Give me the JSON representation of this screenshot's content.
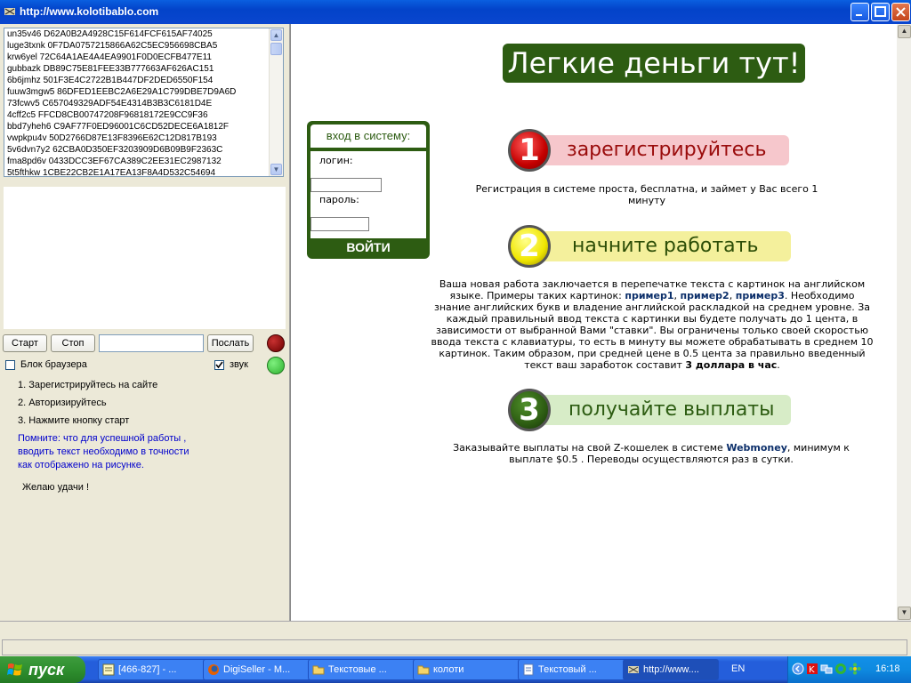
{
  "window": {
    "title": "http://www.kolotibablo.com"
  },
  "left_panel": {
    "log_lines": [
      "un35v46 D62A0B2A4928C15F614FCF615AF74025",
      "luge3txnk 0F7DA0757215866A62C5EC956698CBA5",
      "krw6yel 72C64A1AE4A4EA9901F0D0ECFB477E11",
      "gubbazk DB89C75E81FEE33B777663AF626AC151",
      "6b6jmhz 501F3E4C2722B1B447DF2DED6550F154",
      "fuuw3mgw5 86DFED1EEBC2A6E29A1C799DBE7D9A6D",
      "73fcwv5 C657049329ADF54E4314B3B3C6181D4E",
      "4cff2c5 FFCD8CB00747208F96818172E9CC9F36",
      "bbd7yheh6 C9AF77F0ED96001C6CD52DECE6A1812F",
      "vwpkpu4v 50D2766D87E13F8396E62C12D817B193",
      "5v6dvn7y2 62CBA0D350EF3203909D6B09B9F2363C",
      "fma8pd6v 0433DCC3EF67CA389C2EE31EC2987132",
      "5t5fthkw 1CBE22CB2E1A17EA13F8A4D532C54694"
    ],
    "start_label": "Старт",
    "stop_label": "Стоп",
    "send_label": "Послать",
    "captcha_input_value": "",
    "block_browser_label": "Блок браузера",
    "block_browser_checked": false,
    "sound_label": "звук",
    "sound_checked": true,
    "instructions": [
      "1. Зарегистрируйтесь на сайте",
      "2. Авторизируйтесь",
      "3. Нажмите кнопку старт"
    ],
    "note_lines": [
      "Помните: что для успешной работы ,",
      "вводить текст необходимо в точности",
      "как отображено на рисунке."
    ],
    "wish": "Желаю удачи !",
    "status_colors": {
      "stop": "#8b0000",
      "ok": "#3cc43c"
    }
  },
  "site": {
    "headline": "Легкие деньги тут!",
    "login": {
      "header": "вход в систему:",
      "login_label": "логин:",
      "password_label": "пароль:",
      "submit": "ВОЙТИ"
    },
    "steps": [
      {
        "num": "1",
        "label": "зарегистрируйтесь",
        "color": "#d21414",
        "pill": "#f6c7cc",
        "text_color": "#9a0c0c"
      },
      {
        "num": "2",
        "label": "начните  работать",
        "color": "#f0e600",
        "pill": "#f4f09c",
        "text_color": "#2d4e07"
      },
      {
        "num": "3",
        "label": "получайте выплаты",
        "color": "#2d5c12",
        "pill": "#d7ecc7",
        "text_color": "#2d5c12"
      }
    ],
    "step1_text": "Регистрация в системе проста, бесплатна, и займет у Вас всего 1 минуту",
    "step2_lines": [
      "Ваша новая работа заключается в перепечатке текста с картинок на английском",
      "языке. Примеры таких картинок:",
      "пример1",
      "пример2",
      "пример3",
      ". Необходимо",
      "знание английских букв и владение английской раскладкой на среднем уровне. За",
      "каждый правильный ввод текста с картинки вы будете получать до 1 цента, в",
      "зависимости от выбранной Вами \"ставки\". Вы ограничены только своей скоростью",
      "ввода текста с клавиатуры, то есть в минуту вы можете обрабатывать в среднем 10",
      "картинок. Таким образом, при средней цене в 0.5 цента за правильно введенный",
      "текст ваш заработок составит",
      "3 доллара в час",
      "."
    ],
    "step3_lines": [
      "Заказывайте выплаты на свой Z-кошелек в системе",
      "Webmoney",
      ", минимум к",
      "выплате $0.5 . Переводы осуществляются раз в сутки."
    ]
  },
  "taskbar": {
    "start": "пуск",
    "items": [
      {
        "label": "[466-827] - ...",
        "active": false
      },
      {
        "label": "DigiSeller - M...",
        "active": false
      },
      {
        "label": "Текстовые ...",
        "active": false
      },
      {
        "label": "колоти",
        "active": false
      },
      {
        "label": "Текстовый ...",
        "active": false
      },
      {
        "label": "http://www....",
        "active": true
      }
    ],
    "lang": "EN",
    "clock": "16:18"
  }
}
